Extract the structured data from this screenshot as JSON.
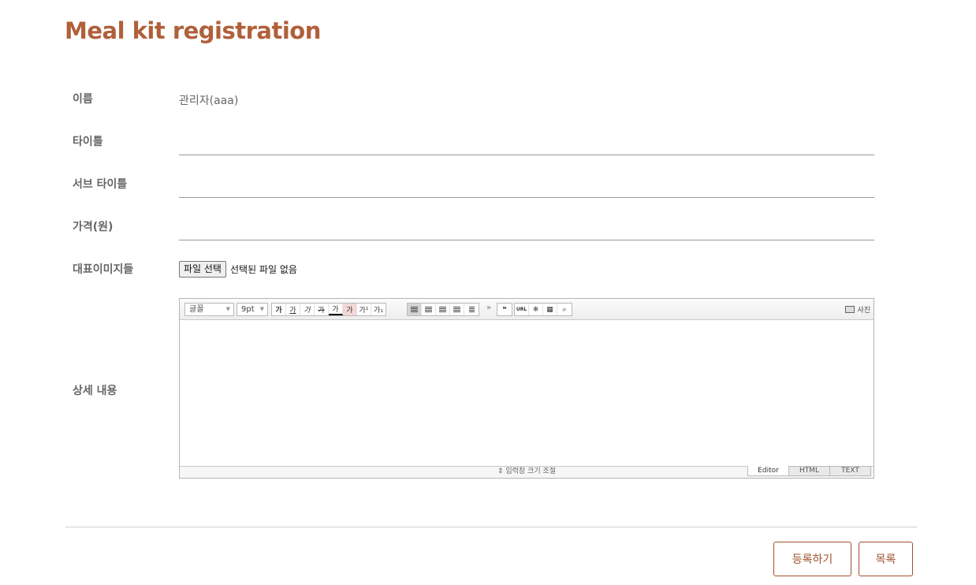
{
  "page_title": "Meal kit registration",
  "form": {
    "name_label": "이름",
    "name_value": "관리자(aaa)",
    "title_label": "타이틀",
    "subtitle_label": "서브 타이틀",
    "price_label": "가격(원)",
    "image_label": "대표이미지들",
    "file_button": "파일 선택",
    "file_status": "선택된 파일 없음",
    "detail_label": "상세 내용"
  },
  "editor": {
    "font_select": "글꼴",
    "size_select": "9pt",
    "format_buttons": [
      "가",
      "가",
      "가",
      "가",
      "가"
    ],
    "color_button": "가",
    "super_sub": [
      "가¹",
      "가₁"
    ],
    "more": "»",
    "quote": "❝",
    "url": "URL",
    "photo": "사진",
    "resize_text": "⇕ 입력창 크기 조절",
    "modes": [
      "Editor",
      "HTML",
      "TEXT"
    ]
  },
  "actions": {
    "submit": "등록하기",
    "list": "목록"
  },
  "colors": {
    "accent": "#a0522d",
    "title": "#b0603a"
  }
}
